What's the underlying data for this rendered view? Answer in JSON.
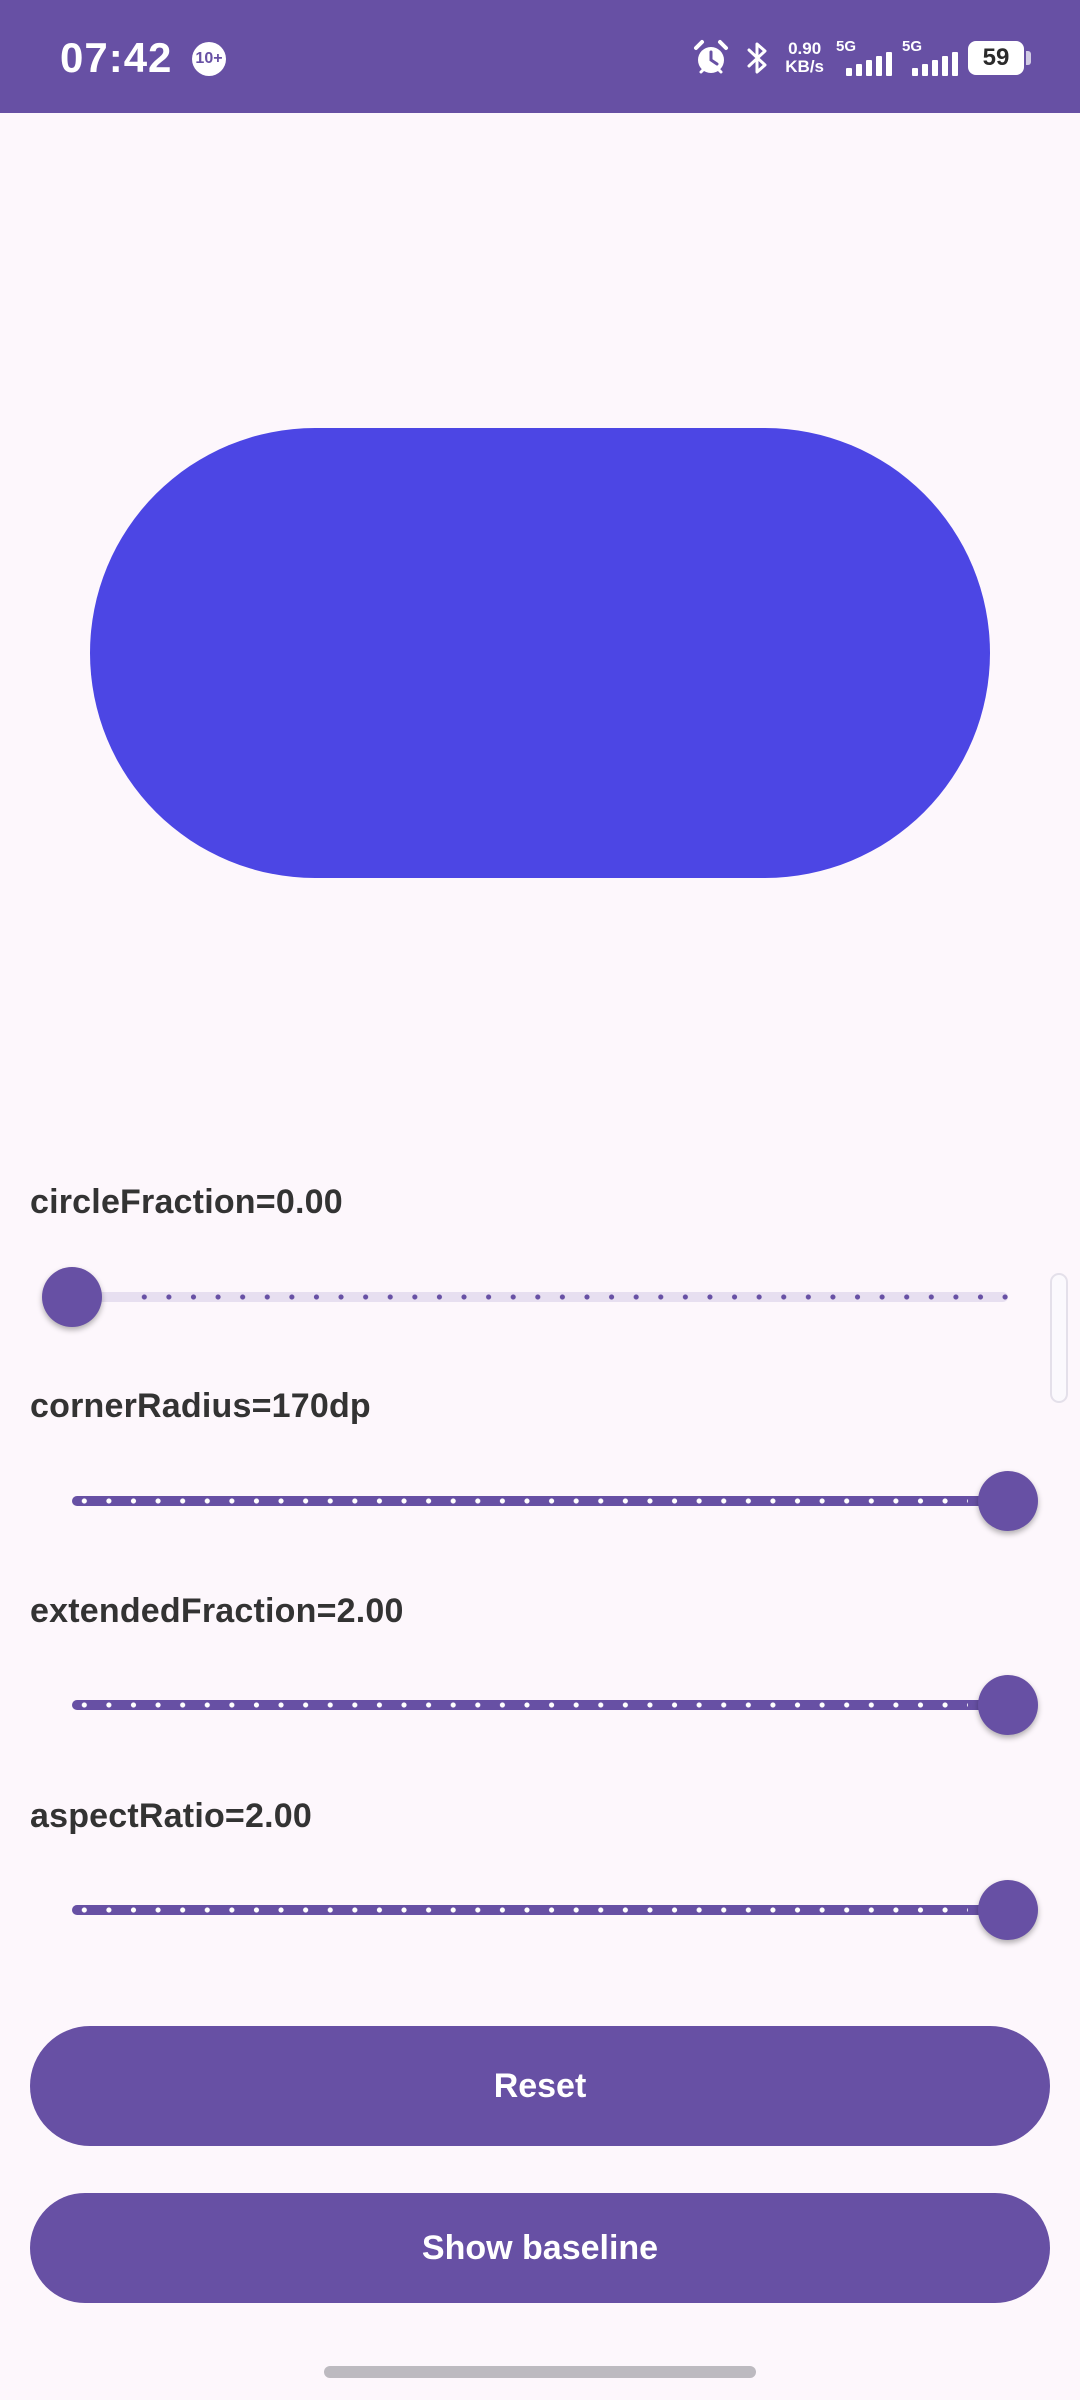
{
  "status_bar": {
    "time": "07:42",
    "notification_badge": "10+",
    "net_speed_value": "0.90",
    "net_speed_unit": "KB/s",
    "signal1_label": "5G",
    "signal2_label": "5G",
    "battery": "59",
    "icons": [
      "alarm-icon",
      "bluetooth-icon",
      "signal-icon",
      "battery-icon"
    ]
  },
  "shape": {
    "color": "#4c46e4"
  },
  "controls": [
    {
      "label": "circleFraction=0.00",
      "value_fraction": 0.0
    },
    {
      "label": "cornerRadius=170dp",
      "value_fraction": 1.0
    },
    {
      "label": "extendedFraction=2.00",
      "value_fraction": 1.0
    },
    {
      "label": "aspectRatio=2.00",
      "value_fraction": 1.0
    }
  ],
  "buttons": {
    "reset": "Reset",
    "show_baseline": "Show baseline"
  },
  "colors": {
    "primary": "#6750a4",
    "background": "#fdf7fc",
    "inactive_track": "#e7dff0"
  }
}
